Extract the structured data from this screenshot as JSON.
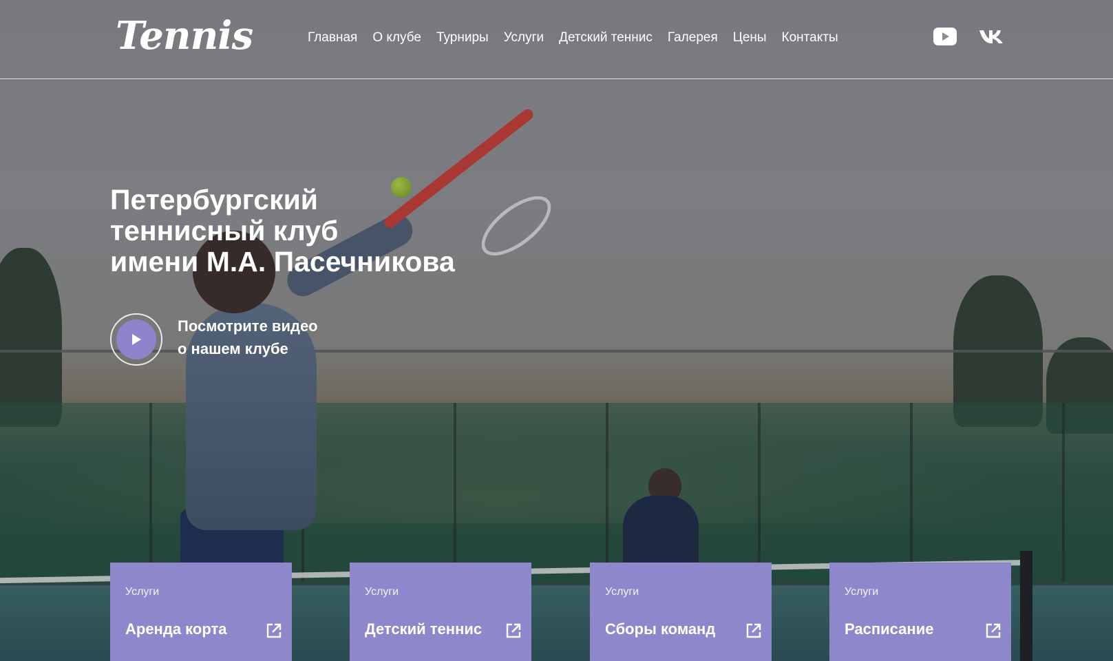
{
  "header": {
    "logo": "Tennis",
    "nav": [
      "Главная",
      "О клубе",
      "Турниры",
      "Услуги",
      "Детский теннис",
      "Галерея",
      "Цены",
      "Контакты"
    ],
    "social": [
      {
        "name": "youtube-icon",
        "symbol": "play-rectangle"
      },
      {
        "name": "vk-icon",
        "symbol": "vk"
      }
    ]
  },
  "hero": {
    "title": "Петербургский\nтеннисный клуб\nимени М.А. Пасечникова",
    "video_cta": "Посмотрите видео\nо нашем клубе",
    "video_button_icon": "play-icon"
  },
  "cards": [
    {
      "category": "Услуги",
      "title": "Аренда корта",
      "icon": "external-link-icon"
    },
    {
      "category": "Услуги",
      "title": "Детский теннис",
      "icon": "external-link-icon"
    },
    {
      "category": "Услуги",
      "title": "Сборы команд",
      "icon": "external-link-icon"
    },
    {
      "category": "Услуги",
      "title": "Расписание",
      "icon": "external-link-icon"
    }
  ],
  "colors": {
    "accent": "#8e87cc",
    "text": "#ffffff"
  }
}
